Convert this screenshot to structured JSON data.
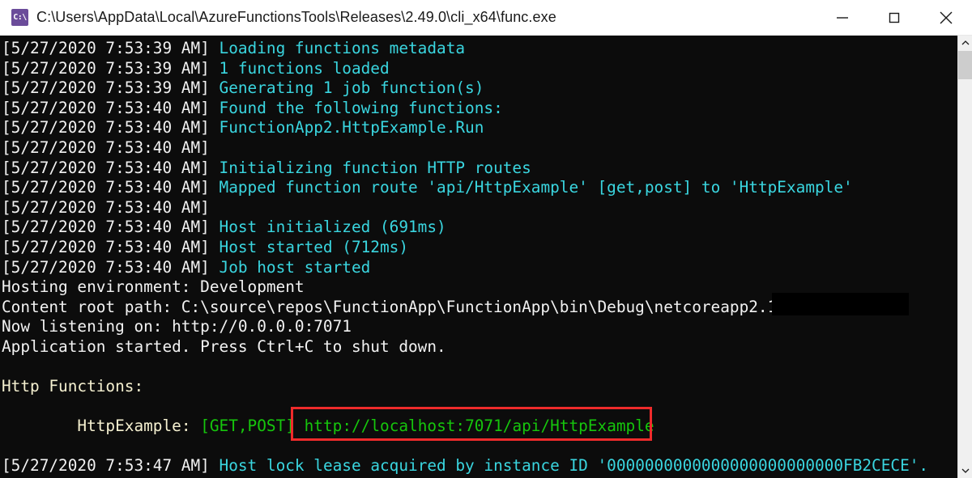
{
  "window": {
    "title": "C:\\Users\\AppData\\Local\\AzureFunctionsTools\\Releases\\2.49.0\\cli_x64\\func.exe",
    "icon": "cmd-console-icon",
    "controls": {
      "minimize": "minimize-button",
      "maximize": "maximize-button",
      "close": "close-button"
    }
  },
  "colors": {
    "background": "#0c0c0c",
    "timestamp": "#f2f2f2",
    "message": "#3ad6e0",
    "plain": "#f2f2f2",
    "heading": "#f5f0d0",
    "url": "#16c60c",
    "highlight_border": "#ef2b2b",
    "titlebar": "#ffffff"
  },
  "console": {
    "lines": [
      {
        "timestamp": "[5/27/2020 7:53:39 AM]",
        "message": "Loading functions metadata",
        "style": "cyan"
      },
      {
        "timestamp": "[5/27/2020 7:53:39 AM]",
        "message": "1 functions loaded",
        "style": "cyan"
      },
      {
        "timestamp": "[5/27/2020 7:53:39 AM]",
        "message": "Generating 1 job function(s)",
        "style": "cyan"
      },
      {
        "timestamp": "[5/27/2020 7:53:40 AM]",
        "message": "Found the following functions:",
        "style": "cyan"
      },
      {
        "timestamp": "[5/27/2020 7:53:40 AM]",
        "message": "FunctionApp2.HttpExample.Run",
        "style": "cyan"
      },
      {
        "timestamp": "[5/27/2020 7:53:40 AM]",
        "message": "",
        "style": "cyan"
      },
      {
        "timestamp": "[5/27/2020 7:53:40 AM]",
        "message": "Initializing function HTTP routes",
        "style": "cyan"
      },
      {
        "timestamp": "[5/27/2020 7:53:40 AM]",
        "message": "Mapped function route 'api/HttpExample' [get,post] to 'HttpExample'",
        "style": "cyan"
      },
      {
        "timestamp": "[5/27/2020 7:53:40 AM]",
        "message": "",
        "style": "cyan"
      },
      {
        "timestamp": "[5/27/2020 7:53:40 AM]",
        "message": "Host initialized (691ms)",
        "style": "cyan"
      },
      {
        "timestamp": "[5/27/2020 7:53:40 AM]",
        "message": "Host started (712ms)",
        "style": "cyan"
      },
      {
        "timestamp": "[5/27/2020 7:53:40 AM]",
        "message": "Job host started",
        "style": "cyan"
      }
    ],
    "plain_lines": [
      "Hosting environment: Development",
      "Content root path: C:\\source\\repos\\FunctionApp\\FunctionApp\\bin\\Debug\\netcoreapp2.1",
      "Now listening on: http://0.0.0.0:7071",
      "Application started. Press Ctrl+C to shut down."
    ],
    "http_functions_heading": "Http Functions:",
    "function_entry": {
      "indent": "        ",
      "name": "HttpExample:",
      "methods": "[GET,POST]",
      "url": "http://localhost:7071/api/HttpExample"
    },
    "final_line": {
      "timestamp": "[5/27/2020 7:53:47 AM]",
      "message": "Host lock lease acquired by instance ID '0000000000000000000000000FB2CECE'."
    }
  },
  "scrollbar": {
    "up_arrow": "scroll-up-arrow",
    "down_arrow": "scroll-down-arrow",
    "thumb": "scroll-thumb"
  }
}
